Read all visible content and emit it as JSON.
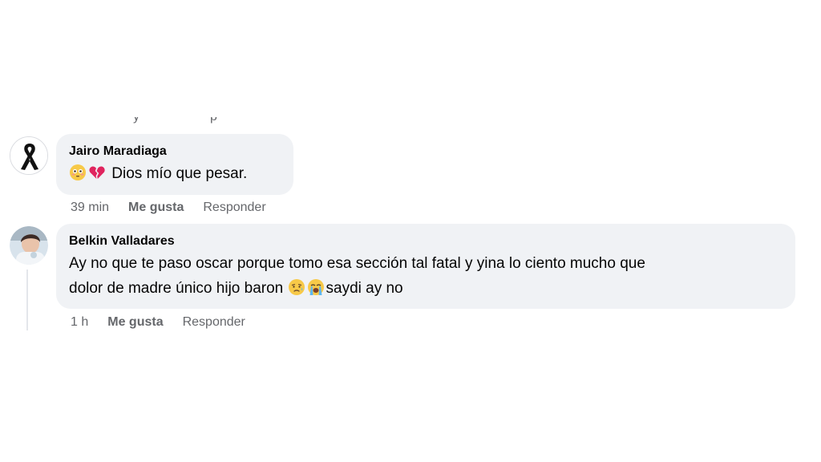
{
  "comments": [
    {
      "author": "Jairo Maradiaga",
      "emojis": [
        "flushed-face",
        "broken-heart"
      ],
      "text": "Dios mío que pesar.",
      "time": "39 min",
      "like_label": "Me gusta",
      "reply_label": "Responder"
    },
    {
      "author": "Belkin Valladares",
      "text_line1": "Ay no que te paso oscar porque tomo esa sección tal fatal y yina lo ciento mucho que",
      "text_line2_before": "dolor de madre único hijo baron",
      "emojis": [
        "sad-but-relieved-face",
        "loudly-crying-face"
      ],
      "text_line2_after": "saydi ay no",
      "time": "1 h",
      "like_label": "Me gusta",
      "reply_label": "Responder"
    }
  ],
  "colors": {
    "bubble": "#f0f2f5",
    "secondary_text": "#65676b",
    "primary_text": "#050505"
  }
}
